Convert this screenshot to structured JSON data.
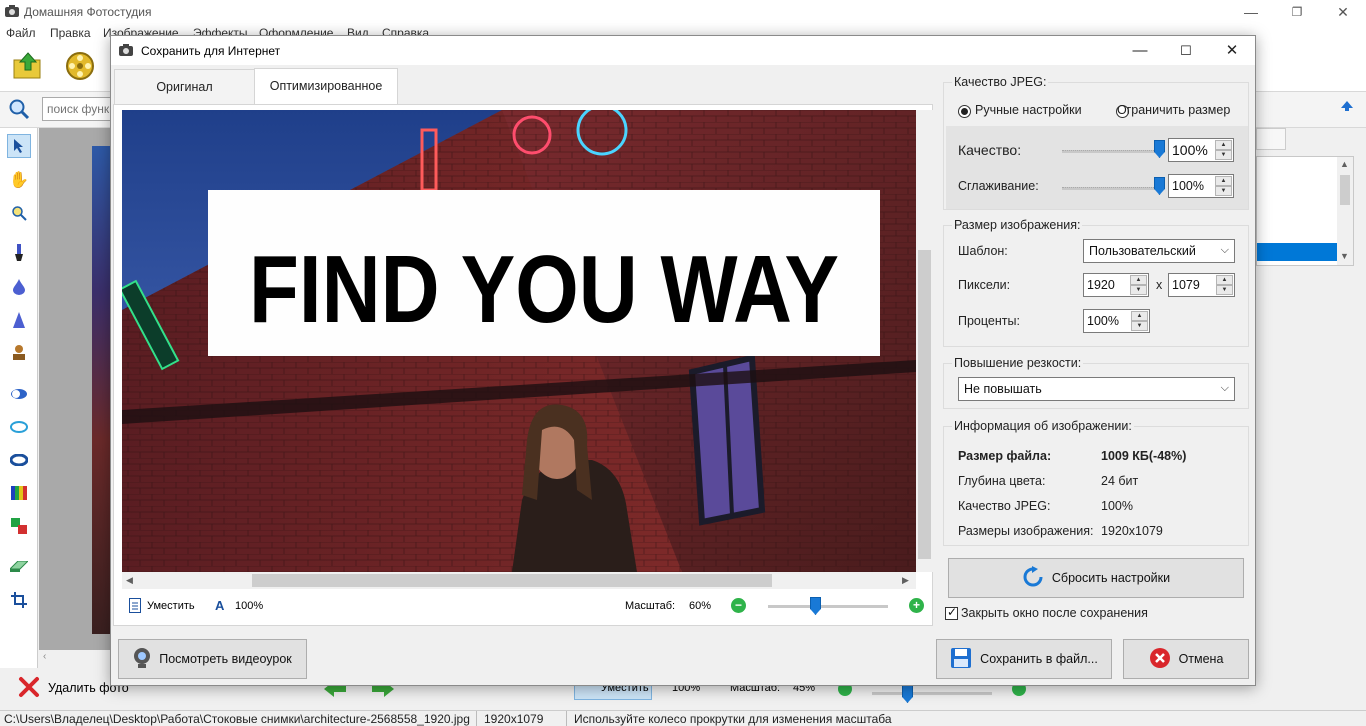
{
  "app": {
    "title": "Домашняя Фотостудия",
    "menu": [
      "Файл",
      "Правка",
      "Изображение",
      "Эффекты",
      "Оформление",
      "Вид",
      "Справка"
    ],
    "search_placeholder": "поиск функ",
    "delete_photo_label": "Удалить фото",
    "bottom_fit_label": "Умеcтить",
    "bottom_zoom_100": "100%",
    "bottom_scale_label": "Масштаб:",
    "bottom_scale_value": "45%"
  },
  "status": {
    "path": "C:\\Users\\Владелец\\Desktop\\Работа\\Стоковые снимки\\architecture-2568558_1920.jpg",
    "dimensions": "1920x1079",
    "hint": "Используйте колесо прокрутки для изменения масштаба"
  },
  "dialog": {
    "title": "Сохранить для Интернет",
    "tabs": [
      {
        "label": "Оригинал",
        "active": false
      },
      {
        "label": "Оптимизированное",
        "active": true
      }
    ],
    "preview": {
      "banner_text": "FIND YOU WAY",
      "fit_label": "Умеcтить",
      "zoom_100_label": "100%",
      "scale_label": "Масштаб:",
      "scale_value": "60%",
      "scale_fraction": 0.4
    },
    "jpeg_quality": {
      "group_title": "Качество JPEG:",
      "radio_manual": "Ручные настройки",
      "radio_limit": "Ограничить размер",
      "selected": "manual",
      "quality_label": "Качество:",
      "quality_value": "100%",
      "quality_fraction": 1.0,
      "smoothing_label": "Сглаживание:",
      "smoothing_value": "100%",
      "smoothing_fraction": 1.0
    },
    "image_size": {
      "group_title": "Размер изображения:",
      "template_label": "Шаблон:",
      "template_value": "Пользовательский",
      "pixels_label": "Пиксели:",
      "width": "1920",
      "times": "x",
      "height": "1079",
      "percent_label": "Проценты:",
      "percent_value": "100%"
    },
    "sharpen": {
      "group_title": "Повышение резкости:",
      "value": "Не повышать"
    },
    "info": {
      "group_title": "Информация об изображении:",
      "rows": [
        {
          "label": "Размер файла:",
          "value": "1009 КБ(-48%)",
          "bold": true
        },
        {
          "label": "Глубина цвета:",
          "value": "24 бит",
          "bold": false
        },
        {
          "label": "Качество JPEG:",
          "value": "100%",
          "bold": false
        },
        {
          "label": "Размеры изображения:",
          "value": "1920x1079",
          "bold": false
        }
      ]
    },
    "reset_button": "Сбросить настройки",
    "close_after_save_label": "Закрыть окно после сохранения",
    "close_after_save_checked": true,
    "video_button": "Посмотреть видеоурок",
    "save_button": "Сохранить в файл...",
    "cancel_button": "Отмена"
  },
  "colors": {
    "accent": "#1979d6",
    "cancel_red": "#d9262b",
    "selection_blue": "#0078d7"
  }
}
